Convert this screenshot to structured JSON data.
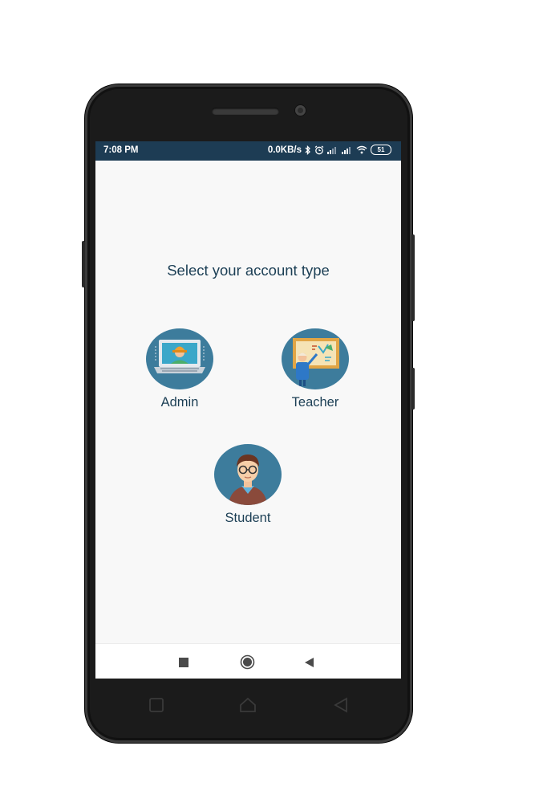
{
  "status_bar": {
    "time": "7:08 PM",
    "net_speed": "0.0KB/s",
    "battery": "51"
  },
  "page": {
    "title": "Select your account type"
  },
  "accounts": [
    {
      "label": "Admin",
      "icon": "admin-icon"
    },
    {
      "label": "Teacher",
      "icon": "teacher-icon"
    },
    {
      "label": "Student",
      "icon": "student-icon"
    }
  ],
  "nav_bar": {
    "buttons": [
      "recents-square-icon",
      "home-circle-icon",
      "back-triangle-icon"
    ]
  },
  "colors": {
    "status_bar": "#1d3c54",
    "text": "#1c3f55",
    "icon_circle": "#3d7c9c",
    "screen_bg": "#f8f8f8",
    "phone_body": "#1b1b1b"
  }
}
